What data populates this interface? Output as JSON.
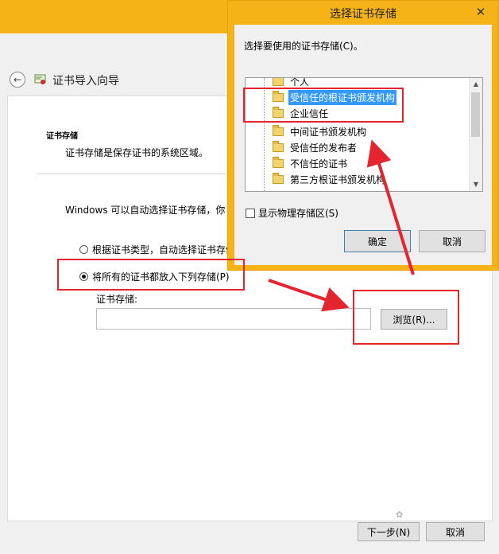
{
  "wizard": {
    "title": "证书导入向导",
    "section_title": "证书存储",
    "section_desc": "证书存储是保存证书的系统区域。",
    "auto_text": "Windows 可以自动选择证书存储，你",
    "radio_auto": "根据证书类型，自动选择证书存储",
    "radio_manual": "将所有的证书都放入下列存储(P)",
    "store_label": "证书存储:",
    "store_value": "",
    "browse_label": "浏览(R)...",
    "next_label": "下一步(N)",
    "cancel_label": "取消"
  },
  "dialog": {
    "title": "选择证书存储",
    "close_glyph": "✕",
    "prompt": "选择要使用的证书存储(C)。",
    "stores": [
      {
        "label": "个人",
        "selected": false
      },
      {
        "label": "受信任的根证书颁发机构",
        "selected": true
      },
      {
        "label": "企业信任",
        "selected": false
      },
      {
        "label": "中间证书颁发机构",
        "selected": false
      },
      {
        "label": "受信任的发布者",
        "selected": false
      },
      {
        "label": "不信任的证书",
        "selected": false
      },
      {
        "label": "第三方根证书颁发机构",
        "selected": false
      }
    ],
    "show_physical": "显示物理存储区(S)",
    "ok_label": "确定",
    "cancel_label": "取消"
  },
  "colors": {
    "titlebar": "#f6b317",
    "selection": "#3399ff",
    "highlight": "#e4252f"
  }
}
